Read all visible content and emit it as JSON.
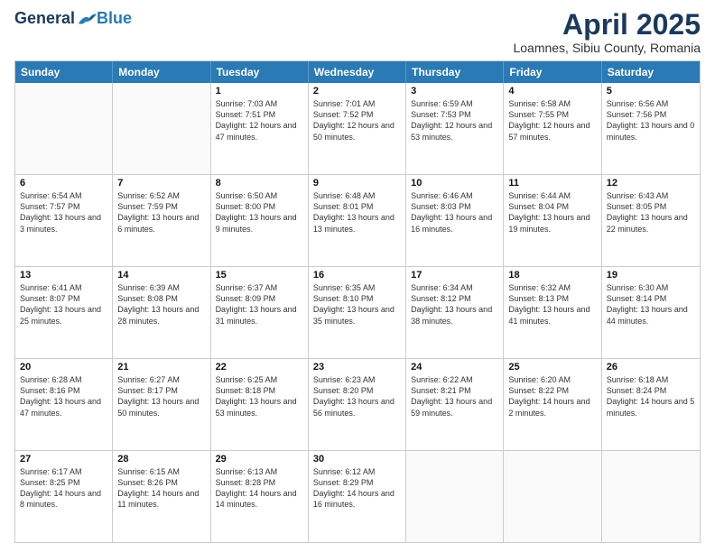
{
  "logo": {
    "general": "General",
    "blue": "Blue"
  },
  "title": {
    "month": "April 2025",
    "location": "Loamnes, Sibiu County, Romania"
  },
  "days": [
    "Sunday",
    "Monday",
    "Tuesday",
    "Wednesday",
    "Thursday",
    "Friday",
    "Saturday"
  ],
  "weeks": [
    [
      {
        "num": "",
        "sunrise": "",
        "sunset": "",
        "daylight": "",
        "empty": true
      },
      {
        "num": "",
        "sunrise": "",
        "sunset": "",
        "daylight": "",
        "empty": true
      },
      {
        "num": "1",
        "sunrise": "Sunrise: 7:03 AM",
        "sunset": "Sunset: 7:51 PM",
        "daylight": "Daylight: 12 hours and 47 minutes."
      },
      {
        "num": "2",
        "sunrise": "Sunrise: 7:01 AM",
        "sunset": "Sunset: 7:52 PM",
        "daylight": "Daylight: 12 hours and 50 minutes."
      },
      {
        "num": "3",
        "sunrise": "Sunrise: 6:59 AM",
        "sunset": "Sunset: 7:53 PM",
        "daylight": "Daylight: 12 hours and 53 minutes."
      },
      {
        "num": "4",
        "sunrise": "Sunrise: 6:58 AM",
        "sunset": "Sunset: 7:55 PM",
        "daylight": "Daylight: 12 hours and 57 minutes."
      },
      {
        "num": "5",
        "sunrise": "Sunrise: 6:56 AM",
        "sunset": "Sunset: 7:56 PM",
        "daylight": "Daylight: 13 hours and 0 minutes."
      }
    ],
    [
      {
        "num": "6",
        "sunrise": "Sunrise: 6:54 AM",
        "sunset": "Sunset: 7:57 PM",
        "daylight": "Daylight: 13 hours and 3 minutes."
      },
      {
        "num": "7",
        "sunrise": "Sunrise: 6:52 AM",
        "sunset": "Sunset: 7:59 PM",
        "daylight": "Daylight: 13 hours and 6 minutes."
      },
      {
        "num": "8",
        "sunrise": "Sunrise: 6:50 AM",
        "sunset": "Sunset: 8:00 PM",
        "daylight": "Daylight: 13 hours and 9 minutes."
      },
      {
        "num": "9",
        "sunrise": "Sunrise: 6:48 AM",
        "sunset": "Sunset: 8:01 PM",
        "daylight": "Daylight: 13 hours and 13 minutes."
      },
      {
        "num": "10",
        "sunrise": "Sunrise: 6:46 AM",
        "sunset": "Sunset: 8:03 PM",
        "daylight": "Daylight: 13 hours and 16 minutes."
      },
      {
        "num": "11",
        "sunrise": "Sunrise: 6:44 AM",
        "sunset": "Sunset: 8:04 PM",
        "daylight": "Daylight: 13 hours and 19 minutes."
      },
      {
        "num": "12",
        "sunrise": "Sunrise: 6:43 AM",
        "sunset": "Sunset: 8:05 PM",
        "daylight": "Daylight: 13 hours and 22 minutes."
      }
    ],
    [
      {
        "num": "13",
        "sunrise": "Sunrise: 6:41 AM",
        "sunset": "Sunset: 8:07 PM",
        "daylight": "Daylight: 13 hours and 25 minutes."
      },
      {
        "num": "14",
        "sunrise": "Sunrise: 6:39 AM",
        "sunset": "Sunset: 8:08 PM",
        "daylight": "Daylight: 13 hours and 28 minutes."
      },
      {
        "num": "15",
        "sunrise": "Sunrise: 6:37 AM",
        "sunset": "Sunset: 8:09 PM",
        "daylight": "Daylight: 13 hours and 31 minutes."
      },
      {
        "num": "16",
        "sunrise": "Sunrise: 6:35 AM",
        "sunset": "Sunset: 8:10 PM",
        "daylight": "Daylight: 13 hours and 35 minutes."
      },
      {
        "num": "17",
        "sunrise": "Sunrise: 6:34 AM",
        "sunset": "Sunset: 8:12 PM",
        "daylight": "Daylight: 13 hours and 38 minutes."
      },
      {
        "num": "18",
        "sunrise": "Sunrise: 6:32 AM",
        "sunset": "Sunset: 8:13 PM",
        "daylight": "Daylight: 13 hours and 41 minutes."
      },
      {
        "num": "19",
        "sunrise": "Sunrise: 6:30 AM",
        "sunset": "Sunset: 8:14 PM",
        "daylight": "Daylight: 13 hours and 44 minutes."
      }
    ],
    [
      {
        "num": "20",
        "sunrise": "Sunrise: 6:28 AM",
        "sunset": "Sunset: 8:16 PM",
        "daylight": "Daylight: 13 hours and 47 minutes."
      },
      {
        "num": "21",
        "sunrise": "Sunrise: 6:27 AM",
        "sunset": "Sunset: 8:17 PM",
        "daylight": "Daylight: 13 hours and 50 minutes."
      },
      {
        "num": "22",
        "sunrise": "Sunrise: 6:25 AM",
        "sunset": "Sunset: 8:18 PM",
        "daylight": "Daylight: 13 hours and 53 minutes."
      },
      {
        "num": "23",
        "sunrise": "Sunrise: 6:23 AM",
        "sunset": "Sunset: 8:20 PM",
        "daylight": "Daylight: 13 hours and 56 minutes."
      },
      {
        "num": "24",
        "sunrise": "Sunrise: 6:22 AM",
        "sunset": "Sunset: 8:21 PM",
        "daylight": "Daylight: 13 hours and 59 minutes."
      },
      {
        "num": "25",
        "sunrise": "Sunrise: 6:20 AM",
        "sunset": "Sunset: 8:22 PM",
        "daylight": "Daylight: 14 hours and 2 minutes."
      },
      {
        "num": "26",
        "sunrise": "Sunrise: 6:18 AM",
        "sunset": "Sunset: 8:24 PM",
        "daylight": "Daylight: 14 hours and 5 minutes."
      }
    ],
    [
      {
        "num": "27",
        "sunrise": "Sunrise: 6:17 AM",
        "sunset": "Sunset: 8:25 PM",
        "daylight": "Daylight: 14 hours and 8 minutes."
      },
      {
        "num": "28",
        "sunrise": "Sunrise: 6:15 AM",
        "sunset": "Sunset: 8:26 PM",
        "daylight": "Daylight: 14 hours and 11 minutes."
      },
      {
        "num": "29",
        "sunrise": "Sunrise: 6:13 AM",
        "sunset": "Sunset: 8:28 PM",
        "daylight": "Daylight: 14 hours and 14 minutes."
      },
      {
        "num": "30",
        "sunrise": "Sunrise: 6:12 AM",
        "sunset": "Sunset: 8:29 PM",
        "daylight": "Daylight: 14 hours and 16 minutes."
      },
      {
        "num": "",
        "sunrise": "",
        "sunset": "",
        "daylight": "",
        "empty": true
      },
      {
        "num": "",
        "sunrise": "",
        "sunset": "",
        "daylight": "",
        "empty": true
      },
      {
        "num": "",
        "sunrise": "",
        "sunset": "",
        "daylight": "",
        "empty": true
      }
    ]
  ]
}
